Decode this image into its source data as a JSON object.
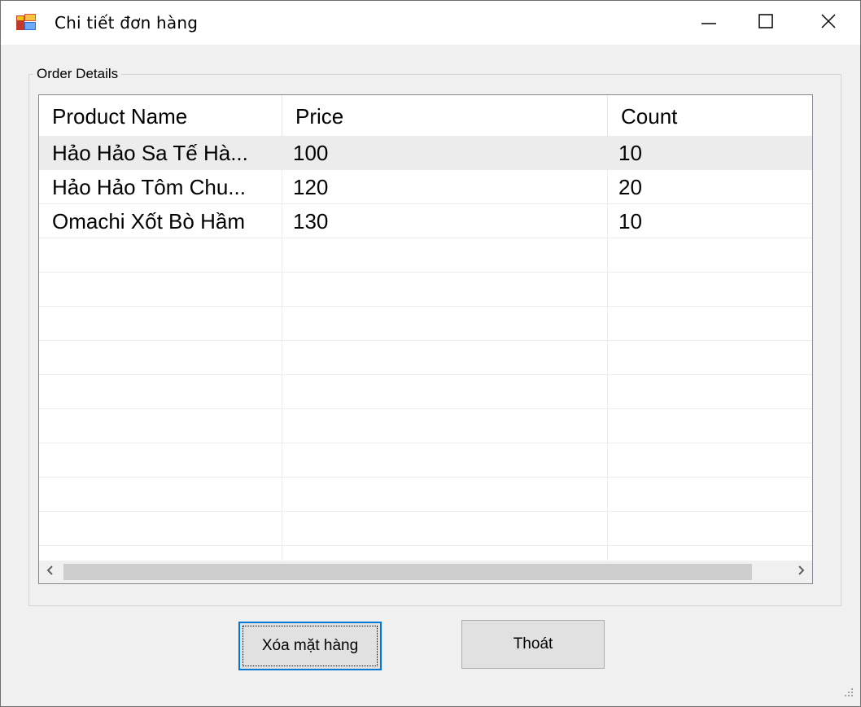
{
  "window": {
    "title": "Chi tiết đơn hàng",
    "icon": "app-form-icon",
    "controls": [
      "minimize-icon",
      "maximize-icon",
      "close-icon"
    ]
  },
  "group": {
    "legend": "Order Details"
  },
  "list": {
    "columns": [
      "Product Name",
      "Price",
      "Count"
    ],
    "rows": [
      {
        "name": "Hảo Hảo Sa Tế Hà...",
        "price": "100",
        "count": "10",
        "selected": true
      },
      {
        "name": "Hảo Hảo Tôm Chu...",
        "price": "120",
        "count": "20",
        "selected": false
      },
      {
        "name": "Omachi Xốt Bò Hầm",
        "price": "130",
        "count": "10",
        "selected": false
      }
    ],
    "scrollbar": {
      "left_icon": "chevron-left-icon",
      "right_icon": "chevron-right-icon"
    }
  },
  "buttons": {
    "delete_label": "Xóa mặt hàng",
    "exit_label": "Thoát"
  },
  "colors": {
    "selection": "#ececec",
    "focus_border": "#0078d7",
    "window_bg": "#f0f0f0",
    "titlebar_bg": "#ffffff"
  }
}
